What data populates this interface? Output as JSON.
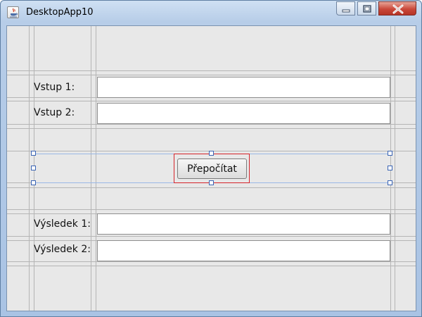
{
  "window": {
    "title": "DesktopApp10"
  },
  "form": {
    "input1_label": "Vstup 1:",
    "input1_value": "",
    "input2_label": "Vstup 2:",
    "input2_value": "",
    "button_label": "Přepočítat",
    "result1_label": "Výsledek 1:",
    "result1_value": "",
    "result2_label": "Výsledek 2:",
    "result2_value": ""
  },
  "colors": {
    "selection_outline": "#d5232a",
    "selection_handles": "#3a64b4",
    "panel_background": "#e8e8e8"
  },
  "icons": [
    "java-cup-icon",
    "minimize-icon",
    "maximize-icon",
    "close-icon"
  ]
}
